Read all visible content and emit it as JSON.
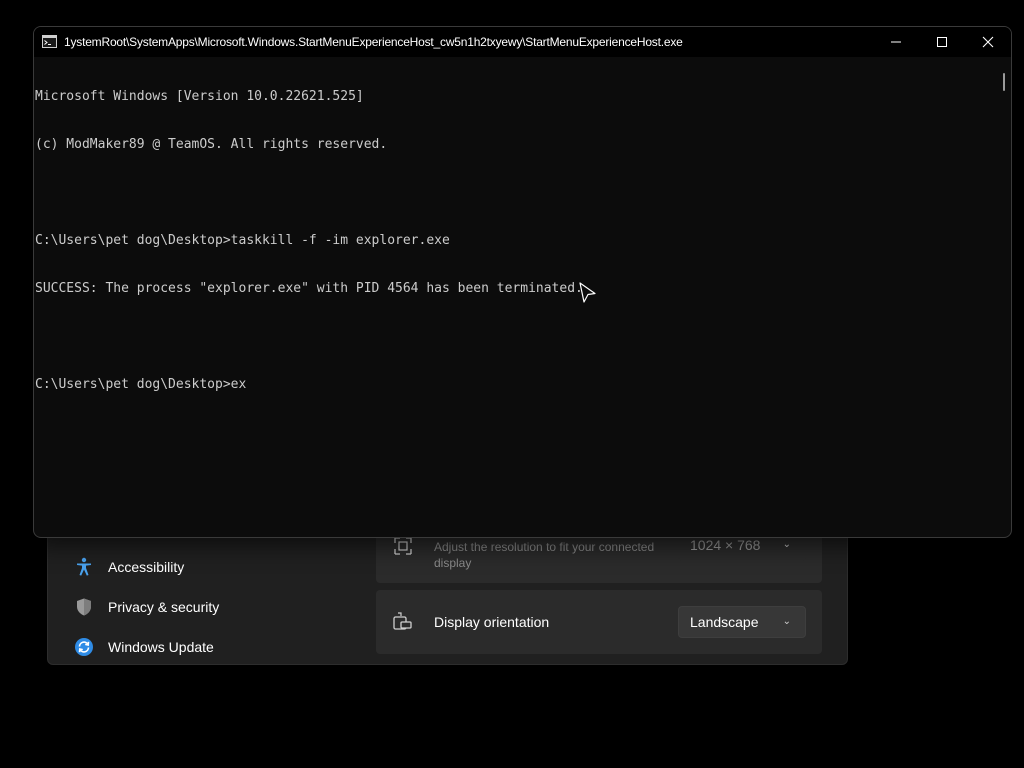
{
  "console": {
    "title": "1ystemRoot\\SystemApps\\Microsoft.Windows.StartMenuExperienceHost_cw5n1h2txyewy\\StartMenuExperienceHost.exe",
    "lines": [
      "Microsoft Windows [Version 10.0.22621.525]",
      "(c) ModMaker89 @ TeamOS. All rights reserved.",
      "",
      "C:\\Users\\pet dog\\Desktop>taskkill -f -im explorer.exe",
      "SUCCESS: The process \"explorer.exe\" with PID 4564 has been terminated.",
      "",
      "C:\\Users\\pet dog\\Desktop>ex"
    ]
  },
  "settings": {
    "nav": [
      {
        "label": "Accessibility",
        "icon": "accessibility-icon"
      },
      {
        "label": "Privacy & security",
        "icon": "shield-icon"
      },
      {
        "label": "Windows Update",
        "icon": "windows-update-icon"
      }
    ],
    "resolution": {
      "description": "Adjust the resolution to fit your connected display",
      "value": "1024 × 768"
    },
    "orientation": {
      "label": "Display orientation",
      "value": "Landscape"
    }
  },
  "colors": {
    "console_bg": "#0c0c0c",
    "console_text": "#cccccc",
    "settings_bg": "#202020",
    "card_bg": "#2b2b2b",
    "accent_blue": "#2f8ce6"
  }
}
